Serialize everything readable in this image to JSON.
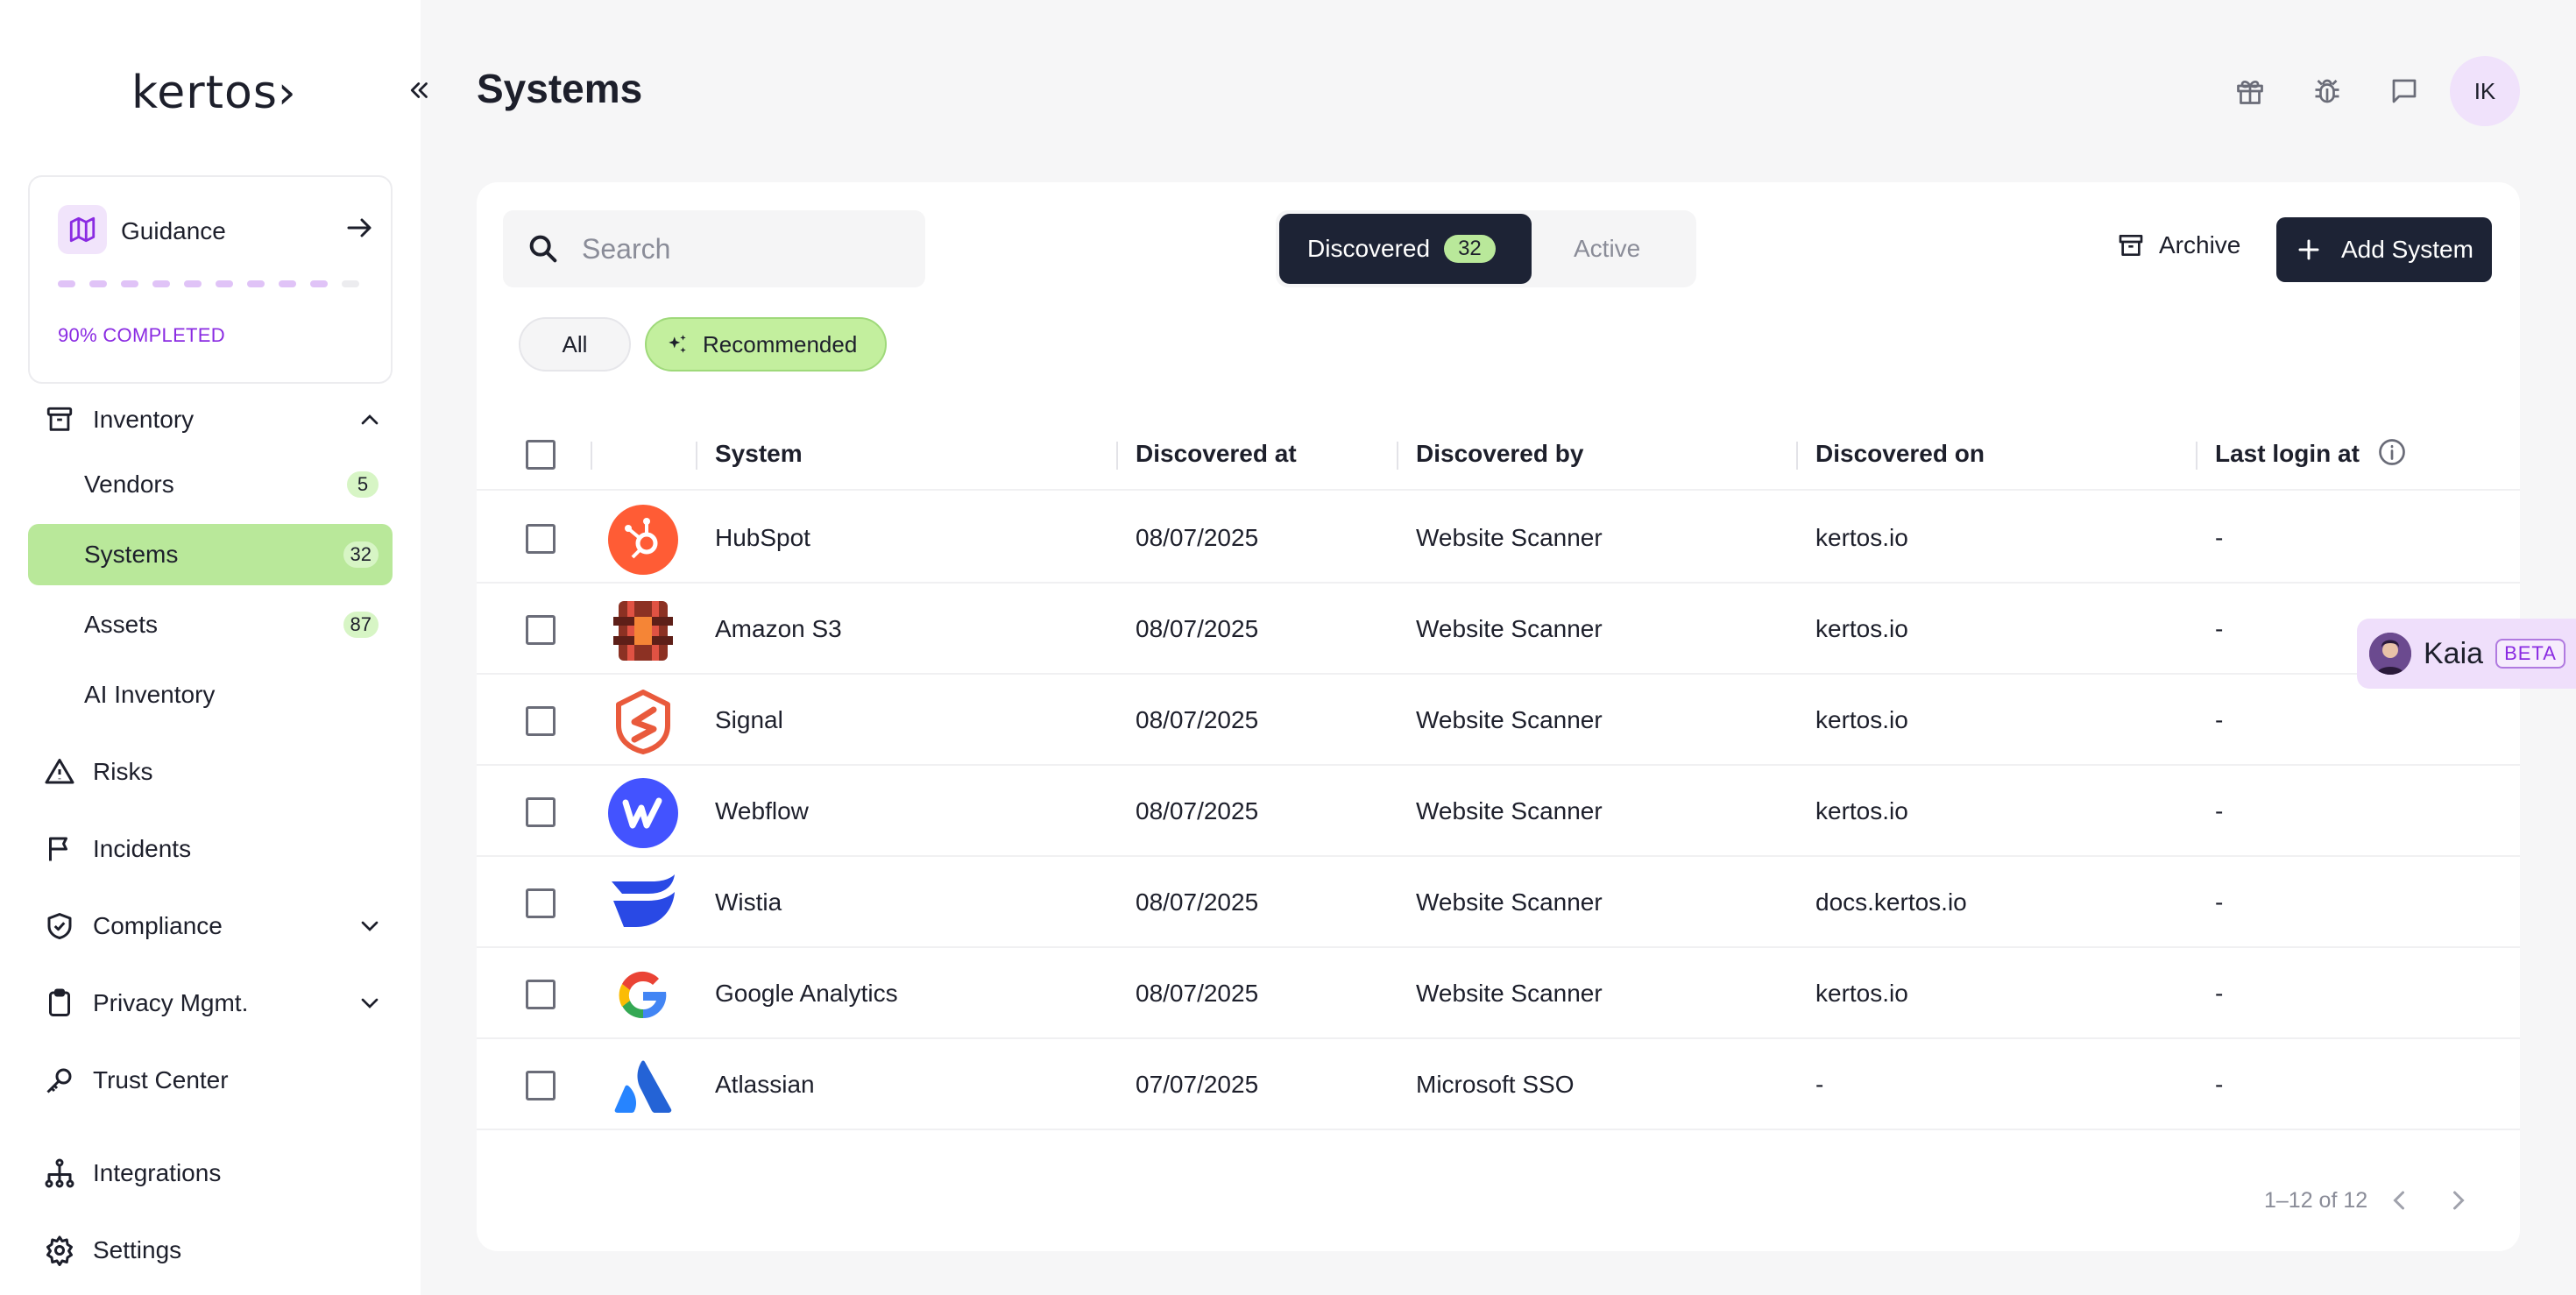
{
  "brand": {
    "logo_text": "kertos›"
  },
  "sidebar": {
    "guidance": {
      "label": "Guidance",
      "progress_text": "90% COMPLETED",
      "progress_fraction": 0.9
    },
    "inventory": {
      "label": "Inventory"
    },
    "sub_items": [
      {
        "label": "Vendors",
        "count": "5"
      },
      {
        "label": "Systems",
        "count": "32"
      },
      {
        "label": "Assets",
        "count": "87"
      },
      {
        "label": "AI Inventory",
        "count": ""
      }
    ],
    "items": [
      {
        "label": "Risks"
      },
      {
        "label": "Incidents"
      },
      {
        "label": "Compliance"
      },
      {
        "label": "Privacy Mgmt."
      },
      {
        "label": "Trust Center"
      },
      {
        "label": "Integrations"
      },
      {
        "label": "Settings"
      }
    ]
  },
  "header": {
    "title": "Systems",
    "avatar_initials": "IK"
  },
  "toolbar": {
    "search_placeholder": "Search",
    "tab_discovered": "Discovered",
    "tab_discovered_count": "32",
    "tab_active": "Active",
    "archive_label": "Archive",
    "add_label": "Add System",
    "filter_all": "All",
    "filter_recommended": "Recommended"
  },
  "table": {
    "columns": [
      "System",
      "Discovered at",
      "Discovered by",
      "Discovered on",
      "Last login at"
    ],
    "rows": [
      {
        "system": "HubSpot",
        "discovered_at": "08/07/2025",
        "discovered_by": "Website Scanner",
        "discovered_on": "kertos.io",
        "last_login": "-"
      },
      {
        "system": "Amazon S3",
        "discovered_at": "08/07/2025",
        "discovered_by": "Website Scanner",
        "discovered_on": "kertos.io",
        "last_login": "-"
      },
      {
        "system": "Signal",
        "discovered_at": "08/07/2025",
        "discovered_by": "Website Scanner",
        "discovered_on": "kertos.io",
        "last_login": "-"
      },
      {
        "system": "Webflow",
        "discovered_at": "08/07/2025",
        "discovered_by": "Website Scanner",
        "discovered_on": "kertos.io",
        "last_login": "-"
      },
      {
        "system": "Wistia",
        "discovered_at": "08/07/2025",
        "discovered_by": "Website Scanner",
        "discovered_on": "docs.kertos.io",
        "last_login": "-"
      },
      {
        "system": "Google Analytics",
        "discovered_at": "08/07/2025",
        "discovered_by": "Website Scanner",
        "discovered_on": "kertos.io",
        "last_login": "-"
      },
      {
        "system": "Atlassian",
        "discovered_at": "07/07/2025",
        "discovered_by": "Microsoft SSO",
        "discovered_on": "-",
        "last_login": "-"
      }
    ],
    "pagination": "1–12 of 12"
  },
  "assistant": {
    "name": "Kaia",
    "badge": "BETA"
  },
  "colors": {
    "accent_green": "#b9e89a",
    "dark_navy": "#1d2335",
    "purple": "#8a2be2"
  }
}
